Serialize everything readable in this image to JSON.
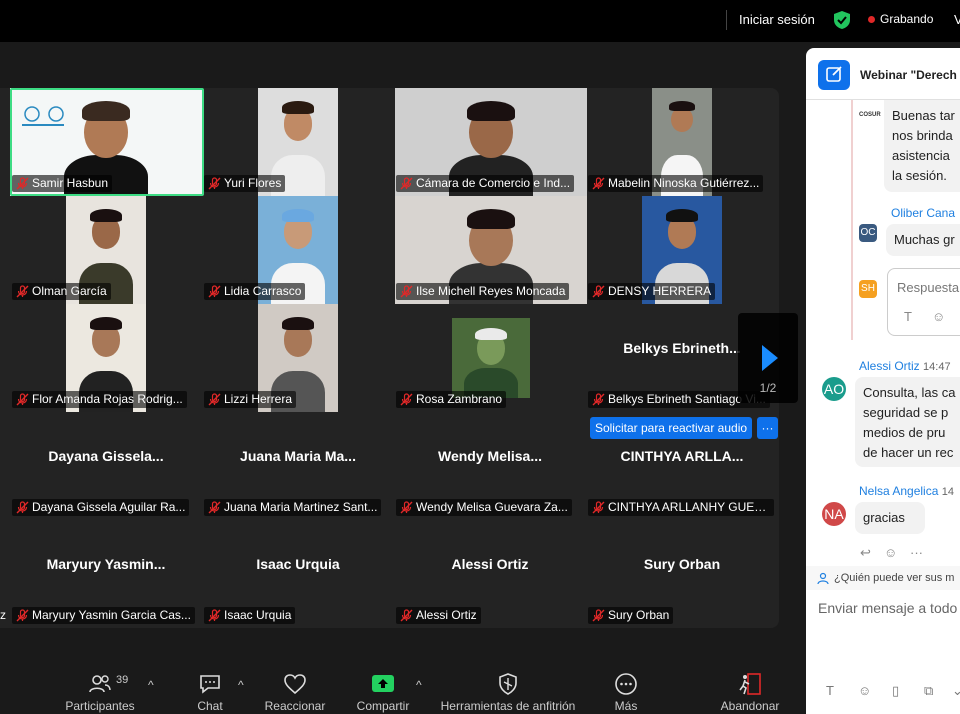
{
  "topbar": {
    "signin": "Iniciar sesión",
    "recording": "Grabando",
    "view": "V"
  },
  "participants": [
    {
      "name": "Samir Hasbun",
      "video": true,
      "active": true
    },
    {
      "name": "Yuri Flores",
      "video": true
    },
    {
      "name": "Cámara de Comercio e Ind...",
      "video": true
    },
    {
      "name": "Mabelin Ninoska Gutiérrez...",
      "video": true
    },
    {
      "name": "Olman García",
      "video": true
    },
    {
      "name": "Lidia Carrasco",
      "video": true
    },
    {
      "name": "Ilse Michell Reyes Moncada",
      "video": true
    },
    {
      "name": "DENSY HERRERA",
      "video": true
    },
    {
      "name": "Flor Amanda Rojas Rodrig...",
      "video": true
    },
    {
      "name": "Lizzi Herrera",
      "video": true
    },
    {
      "name": "Rosa Zambrano",
      "video": true
    },
    {
      "name": "Belkys Ebrineth Santiago Vi...",
      "display": "Belkys  Ebrineth...",
      "video": false
    },
    {
      "name": "Dayana Gissela Aguilar Ra...",
      "display": "Dayana  Gissela...",
      "video": false
    },
    {
      "name": "Juana Maria Martinez Sant...",
      "display": "Juana  Maria  Ma...",
      "video": false
    },
    {
      "name": "Wendy  Melisa Guevara Za...",
      "display": "Wendy   Melisa...",
      "video": false
    },
    {
      "name": "CINTHYA ARLLANHY GUER...",
      "display": "CINTHYA  ARLLA...",
      "video": false
    },
    {
      "name": "Maryury Yasmin Garcia Cas...",
      "display": "Maryury  Yasmin...",
      "video": false
    },
    {
      "name": "Isaac Urquia",
      "display": "Isaac Urquia",
      "video": false
    },
    {
      "name": "Alessi Ortiz",
      "display": "Alessi Ortiz",
      "video": false
    },
    {
      "name": "Sury Orban",
      "display": "Sury Orban",
      "video": false
    }
  ],
  "gallery": {
    "reactivate_audio": "Solicitar para reactivar audio",
    "more": "···",
    "page_indicator": "1/2",
    "edge_label": "z"
  },
  "toolbar": {
    "participants": "Participantes",
    "participants_count": "39",
    "chat": "Chat",
    "react": "Reaccionar",
    "share": "Compartir",
    "host_tools": "Herramientas de anfitrión",
    "more": "Más",
    "leave": "Abandonar"
  },
  "chat": {
    "title": "Webinar \"Derech",
    "msg1_lines": [
      "Buenas tar",
      "nos brinda",
      "asistencia",
      "la sesión."
    ],
    "msg1_logo": "COSUR",
    "sender2": "Oliber Cana",
    "avatar2": "OC",
    "msg2": "Muchas gr",
    "avatar3": "SH",
    "reply_placeholder": "Respuesta",
    "sender4": "Alessi Ortiz",
    "time4": "14:47",
    "avatar4": "AO",
    "msg4_lines": [
      "Consulta, las ca",
      "seguridad se p",
      "medios de pru",
      "de hacer un rec"
    ],
    "sender5": "Nelsa Angelica",
    "time5": "14",
    "avatar5": "NA",
    "msg5": "gracias",
    "who_sees": "¿Quién puede ver sus m",
    "input_placeholder": "Enviar mensaje a todo"
  },
  "colors": {
    "accent": "#0e71eb",
    "active_speaker": "#3ddc84",
    "recording": "#e02828",
    "mute": "#e02828"
  }
}
